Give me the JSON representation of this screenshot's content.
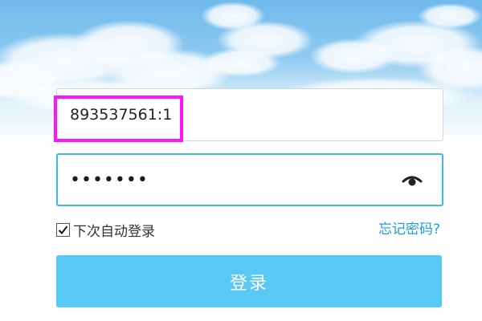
{
  "login": {
    "username_value": "893537561:1",
    "password_display": "•••••••",
    "remember_checked": true,
    "remember_label": "下次自动登录",
    "forgot_label": "忘记密码?",
    "login_button_label": "登录"
  },
  "icons": {
    "show_password": "eye-icon",
    "remember_checkbox": "checkmark-icon"
  },
  "colors": {
    "accent": "#3fb8e4",
    "login_button": "#58c8f4",
    "link": "#1aa0d8",
    "highlight": "#ff12ff"
  }
}
